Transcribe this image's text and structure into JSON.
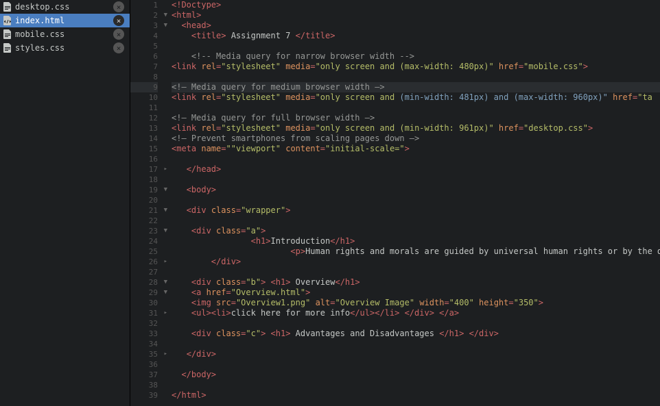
{
  "sidebar": {
    "files": [
      {
        "name": "desktop.css",
        "type": "css",
        "active": false
      },
      {
        "name": "index.html",
        "type": "html",
        "active": true
      },
      {
        "name": "mobile.css",
        "type": "css",
        "active": false
      },
      {
        "name": "styles.css",
        "type": "css",
        "active": false
      }
    ]
  },
  "editor": {
    "highlighted_line": 9,
    "lines": [
      {
        "n": 1,
        "fold": "",
        "tokens": [
          [
            "t-red",
            "<!Doctype>"
          ]
        ]
      },
      {
        "n": 2,
        "fold": "▼",
        "tokens": [
          [
            "t-red",
            "<html>"
          ]
        ]
      },
      {
        "n": 3,
        "fold": "▼",
        "tokens": [
          [
            "t-white",
            "  "
          ],
          [
            "t-red",
            "<head>"
          ]
        ]
      },
      {
        "n": 4,
        "fold": "",
        "tokens": [
          [
            "t-white",
            "    "
          ],
          [
            "t-red",
            "<title>"
          ],
          [
            "t-white",
            " Assignment 7 "
          ],
          [
            "t-red",
            "</title>"
          ]
        ]
      },
      {
        "n": 5,
        "fold": "",
        "tokens": [
          [
            "",
            ""
          ]
        ]
      },
      {
        "n": 6,
        "fold": "",
        "tokens": [
          [
            "t-white",
            "    "
          ],
          [
            "t-gray",
            "<!-- Media query for narrow browser width -->"
          ]
        ]
      },
      {
        "n": 7,
        "fold": "",
        "tokens": [
          [
            "t-red",
            "<link "
          ],
          [
            "t-orange",
            "rel"
          ],
          [
            "t-red",
            "="
          ],
          [
            "t-green",
            "\"stylesheet\""
          ],
          [
            "t-white",
            " "
          ],
          [
            "t-orange",
            "media"
          ],
          [
            "t-red",
            "="
          ],
          [
            "t-green",
            "\"only screen and (max-width: 480px)\""
          ],
          [
            "t-white",
            " "
          ],
          [
            "t-orange",
            "href"
          ],
          [
            "t-red",
            "="
          ],
          [
            "t-green",
            "\"mobile.css\""
          ],
          [
            "t-red",
            ">"
          ]
        ]
      },
      {
        "n": 8,
        "fold": "",
        "tokens": [
          [
            "",
            ""
          ]
        ]
      },
      {
        "n": 9,
        "fold": "",
        "tokens": [
          [
            "t-gray",
            "<!— Media query for medium browser width —>"
          ]
        ]
      },
      {
        "n": 10,
        "fold": "",
        "tokens": [
          [
            "t-red",
            "<link "
          ],
          [
            "t-orange",
            "rel"
          ],
          [
            "t-red",
            "="
          ],
          [
            "t-green",
            "\"stylesheet\""
          ],
          [
            "t-white",
            " "
          ],
          [
            "t-orange",
            "media"
          ],
          [
            "t-red",
            "="
          ],
          [
            "t-green",
            "\"only screen and"
          ],
          [
            "t-white",
            " "
          ],
          [
            "t-blue",
            "(min-width: 481px) and (max-width: 960px)\""
          ],
          [
            "t-white",
            " "
          ],
          [
            "t-orange",
            "href"
          ],
          [
            "t-red",
            "="
          ],
          [
            "t-green",
            "\"ta"
          ]
        ]
      },
      {
        "n": 11,
        "fold": "",
        "tokens": [
          [
            "",
            ""
          ]
        ]
      },
      {
        "n": 12,
        "fold": "",
        "tokens": [
          [
            "t-gray",
            "<!— Media query for full browser width —>"
          ]
        ]
      },
      {
        "n": 13,
        "fold": "",
        "tokens": [
          [
            "t-red",
            "<link "
          ],
          [
            "t-orange",
            "rel"
          ],
          [
            "t-red",
            "="
          ],
          [
            "t-green",
            "\"stylesheet\""
          ],
          [
            "t-white",
            " "
          ],
          [
            "t-orange",
            "media"
          ],
          [
            "t-red",
            "="
          ],
          [
            "t-green",
            "\"only screen and (min-width: 961px)\""
          ],
          [
            "t-white",
            " "
          ],
          [
            "t-orange",
            "href"
          ],
          [
            "t-red",
            "="
          ],
          [
            "t-green",
            "\"desktop.css\""
          ],
          [
            "t-red",
            ">"
          ]
        ]
      },
      {
        "n": 14,
        "fold": "",
        "tokens": [
          [
            "t-gray",
            "<!— Prevent smartphones from scaling pages down —>"
          ]
        ]
      },
      {
        "n": 15,
        "fold": "",
        "tokens": [
          [
            "t-red",
            "<meta "
          ],
          [
            "t-orange",
            "name"
          ],
          [
            "t-red",
            "="
          ],
          [
            "t-green",
            "\"\"viewport\""
          ],
          [
            "t-white",
            " "
          ],
          [
            "t-orange",
            "content"
          ],
          [
            "t-red",
            "="
          ],
          [
            "t-green",
            "\"initial-scale=\""
          ],
          [
            "t-red",
            ">"
          ]
        ]
      },
      {
        "n": 16,
        "fold": "",
        "tokens": [
          [
            "",
            ""
          ]
        ]
      },
      {
        "n": 17,
        "fold": "▸",
        "tokens": [
          [
            "t-white",
            "   "
          ],
          [
            "t-red",
            "</head>"
          ]
        ]
      },
      {
        "n": 18,
        "fold": "",
        "tokens": [
          [
            "",
            ""
          ]
        ]
      },
      {
        "n": 19,
        "fold": "▼",
        "tokens": [
          [
            "t-white",
            "   "
          ],
          [
            "t-red",
            "<body>"
          ]
        ]
      },
      {
        "n": 20,
        "fold": "",
        "tokens": [
          [
            "",
            ""
          ]
        ]
      },
      {
        "n": 21,
        "fold": "▼",
        "tokens": [
          [
            "t-white",
            "   "
          ],
          [
            "t-red",
            "<div "
          ],
          [
            "t-orange",
            "class"
          ],
          [
            "t-red",
            "="
          ],
          [
            "t-green",
            "\"wrapper\""
          ],
          [
            "t-red",
            ">"
          ]
        ]
      },
      {
        "n": 22,
        "fold": "",
        "tokens": [
          [
            "",
            ""
          ]
        ]
      },
      {
        "n": 23,
        "fold": "▼",
        "tokens": [
          [
            "t-white",
            "    "
          ],
          [
            "t-red",
            "<div "
          ],
          [
            "t-orange",
            "class"
          ],
          [
            "t-red",
            "="
          ],
          [
            "t-green",
            "\"a\""
          ],
          [
            "t-red",
            ">"
          ]
        ]
      },
      {
        "n": 24,
        "fold": "",
        "tokens": [
          [
            "t-white",
            "                "
          ],
          [
            "t-red",
            "<h1>"
          ],
          [
            "t-white",
            "Introduction"
          ],
          [
            "t-red",
            "</h1>"
          ]
        ]
      },
      {
        "n": 25,
        "fold": "",
        "tokens": [
          [
            "t-white",
            "                        "
          ],
          [
            "t-red",
            "<p>"
          ],
          [
            "t-white",
            "Human rights and morals are guided by universal human rights or by the di"
          ]
        ]
      },
      {
        "n": 26,
        "fold": "▸",
        "tokens": [
          [
            "t-white",
            "        "
          ],
          [
            "t-red",
            "</div>"
          ]
        ]
      },
      {
        "n": 27,
        "fold": "",
        "tokens": [
          [
            "",
            ""
          ]
        ]
      },
      {
        "n": 28,
        "fold": "▼",
        "tokens": [
          [
            "t-white",
            "    "
          ],
          [
            "t-red",
            "<div "
          ],
          [
            "t-orange",
            "class"
          ],
          [
            "t-red",
            "="
          ],
          [
            "t-green",
            "\"b\""
          ],
          [
            "t-red",
            ">"
          ],
          [
            "t-white",
            " "
          ],
          [
            "t-red",
            "<h1>"
          ],
          [
            "t-white",
            " Overview"
          ],
          [
            "t-red",
            "</h1>"
          ]
        ]
      },
      {
        "n": 29,
        "fold": "▼",
        "tokens": [
          [
            "t-white",
            "    "
          ],
          [
            "t-red",
            "<a "
          ],
          [
            "t-orange",
            "href"
          ],
          [
            "t-red",
            "="
          ],
          [
            "t-green",
            "\"Overview.html\""
          ],
          [
            "t-red",
            ">"
          ]
        ]
      },
      {
        "n": 30,
        "fold": "",
        "tokens": [
          [
            "t-white",
            "    "
          ],
          [
            "t-red",
            "<img "
          ],
          [
            "t-orange",
            "src"
          ],
          [
            "t-red",
            "="
          ],
          [
            "t-green",
            "\"Overview1.png\""
          ],
          [
            "t-white",
            " "
          ],
          [
            "t-orange",
            "alt"
          ],
          [
            "t-red",
            "="
          ],
          [
            "t-green",
            "\"Overview Image\""
          ],
          [
            "t-white",
            " "
          ],
          [
            "t-orange",
            "width"
          ],
          [
            "t-red",
            "="
          ],
          [
            "t-green",
            "\"400\""
          ],
          [
            "t-white",
            " "
          ],
          [
            "t-orange",
            "height"
          ],
          [
            "t-red",
            "="
          ],
          [
            "t-green",
            "\"350\""
          ],
          [
            "t-red",
            ">"
          ]
        ]
      },
      {
        "n": 31,
        "fold": "▸",
        "tokens": [
          [
            "t-white",
            "    "
          ],
          [
            "t-red",
            "<ul><li>"
          ],
          [
            "t-white",
            "click here for more info"
          ],
          [
            "t-red",
            "</ul></li>"
          ],
          [
            "t-white",
            " "
          ],
          [
            "t-red",
            "</div>"
          ],
          [
            "t-white",
            " "
          ],
          [
            "t-red",
            "</a>"
          ]
        ]
      },
      {
        "n": 32,
        "fold": "",
        "tokens": [
          [
            "",
            ""
          ]
        ]
      },
      {
        "n": 33,
        "fold": "",
        "tokens": [
          [
            "t-white",
            "    "
          ],
          [
            "t-red",
            "<div "
          ],
          [
            "t-orange",
            "class"
          ],
          [
            "t-red",
            "="
          ],
          [
            "t-green",
            "\"c\""
          ],
          [
            "t-red",
            ">"
          ],
          [
            "t-white",
            " "
          ],
          [
            "t-red",
            "<h1>"
          ],
          [
            "t-white",
            " Advantages and Disadvantages "
          ],
          [
            "t-red",
            "</h1>"
          ],
          [
            "t-white",
            " "
          ],
          [
            "t-red",
            "</div>"
          ]
        ]
      },
      {
        "n": 34,
        "fold": "",
        "tokens": [
          [
            "",
            ""
          ]
        ]
      },
      {
        "n": 35,
        "fold": "▸",
        "tokens": [
          [
            "t-white",
            "   "
          ],
          [
            "t-red",
            "</div>"
          ]
        ]
      },
      {
        "n": 36,
        "fold": "",
        "tokens": [
          [
            "",
            ""
          ]
        ]
      },
      {
        "n": 37,
        "fold": "",
        "tokens": [
          [
            "t-white",
            "  "
          ],
          [
            "t-red",
            "</body>"
          ]
        ]
      },
      {
        "n": 38,
        "fold": "",
        "tokens": [
          [
            "",
            ""
          ]
        ]
      },
      {
        "n": 39,
        "fold": "",
        "tokens": [
          [
            "t-red",
            "</html>"
          ]
        ]
      }
    ]
  }
}
